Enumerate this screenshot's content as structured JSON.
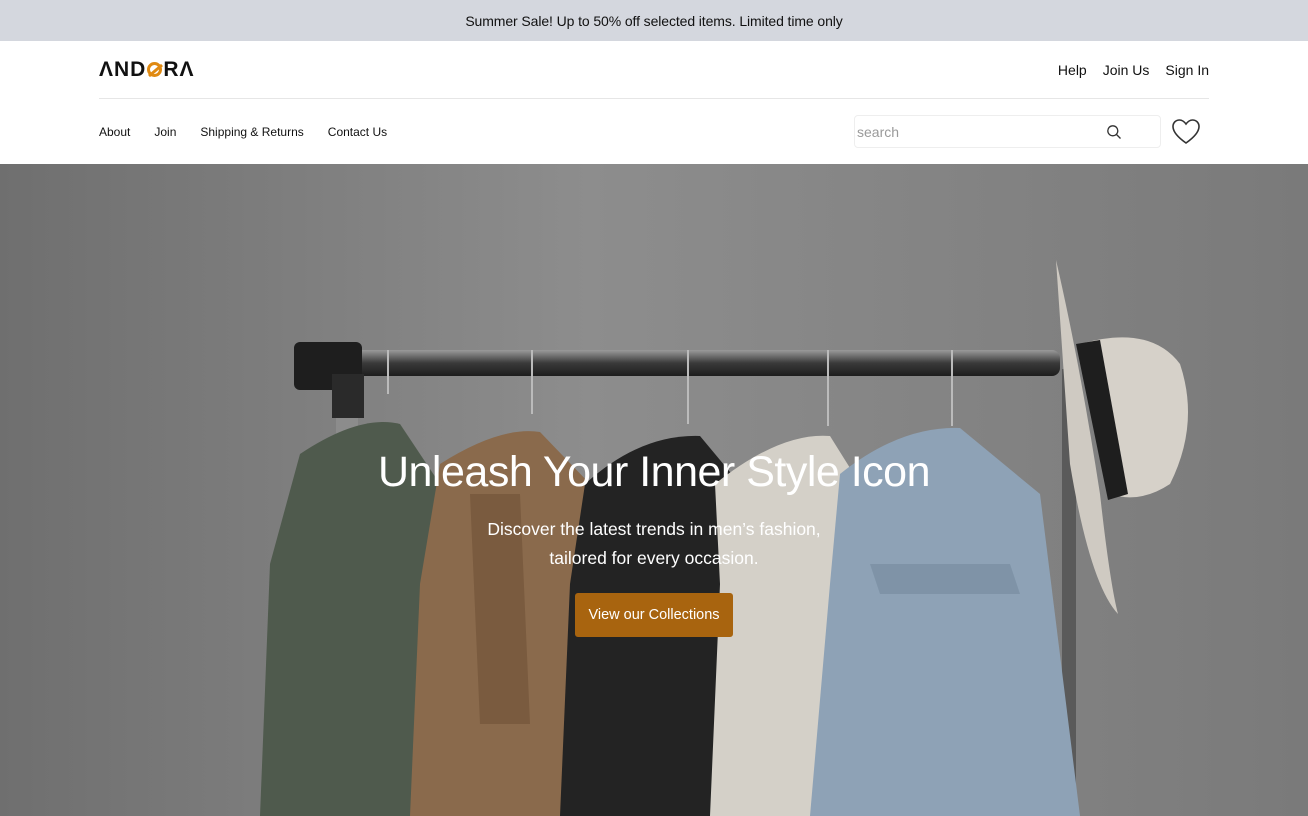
{
  "promo": {
    "text": "Summer Sale! Up to 50% off selected items. Limited time only"
  },
  "brand": {
    "logo_text": "ANDORA",
    "accent_color": "#e08a12"
  },
  "top_links": [
    {
      "label": "Help"
    },
    {
      "label": "Join Us"
    },
    {
      "label": "Sign In"
    }
  ],
  "nav": {
    "items": [
      {
        "label": "About"
      },
      {
        "label": "Join"
      },
      {
        "label": "Shipping & Returns"
      },
      {
        "label": "Contact Us"
      }
    ]
  },
  "search": {
    "placeholder": "search",
    "value": "",
    "icon": "search-icon"
  },
  "wishlist": {
    "icon": "heart-icon"
  },
  "hero": {
    "title": "Unleash Your Inner Style Icon",
    "subtitle_line1": "Discover the latest trends in men’s fashion,",
    "subtitle_line2": "tailored for every occasion.",
    "cta_label": "View our Collections",
    "cta_color": "#a8640f"
  }
}
